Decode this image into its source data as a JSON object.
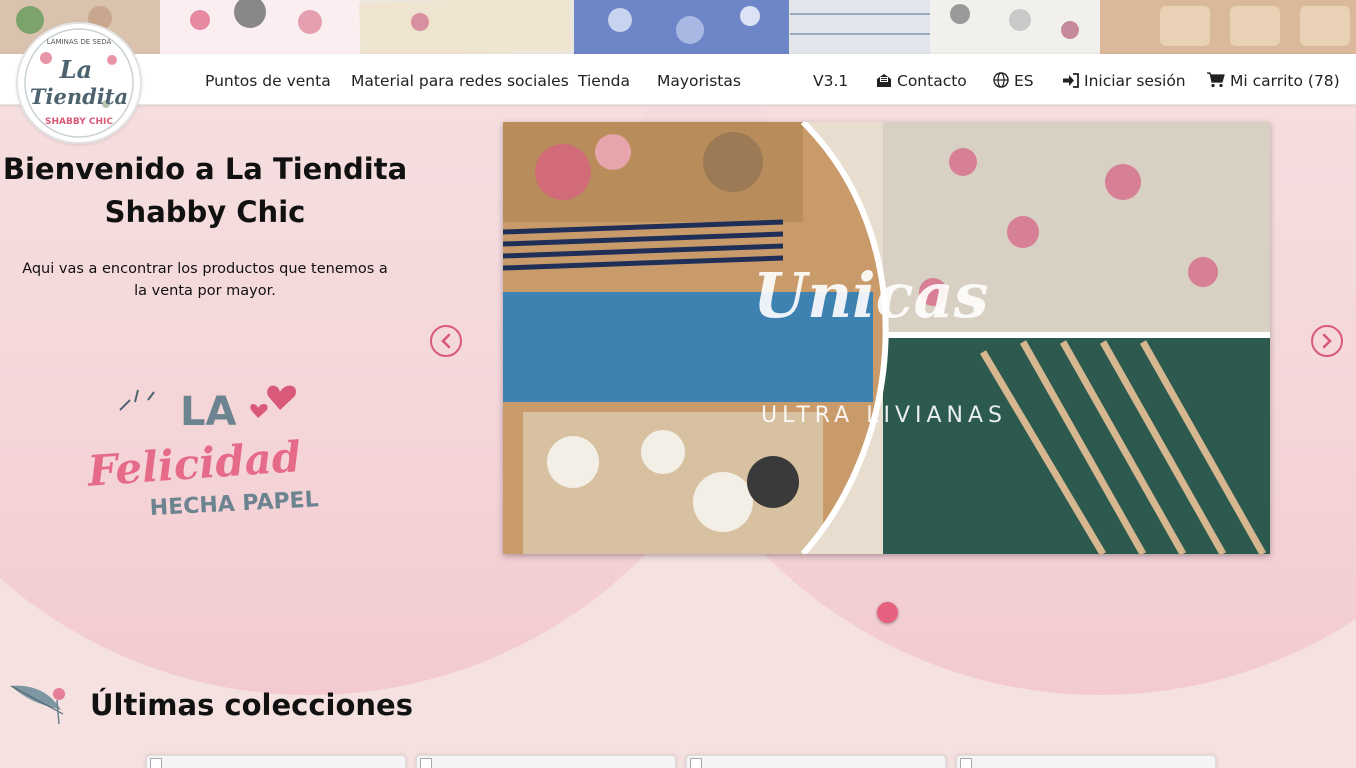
{
  "logo": {
    "top_text": "LÁMINAS DE SEDA",
    "main_line1": "La",
    "main_line2": "Tiendita",
    "bottom_text": "SHABBY CHIC"
  },
  "nav": {
    "left_items": [
      {
        "label": "Puntos de venta"
      },
      {
        "label": "Material para redes sociales"
      },
      {
        "label": "Tienda"
      },
      {
        "label": "Mayoristas"
      }
    ],
    "version": "V3.1",
    "contact": {
      "label": "Contacto",
      "icon": "envelope-open-icon"
    },
    "language": {
      "label": "ES",
      "icon": "globe-icon"
    },
    "login": {
      "label": "Iniciar sesión",
      "icon": "sign-in-icon"
    },
    "cart": {
      "label": "Mi carrito (78)",
      "icon": "shopping-cart-icon"
    }
  },
  "hero": {
    "title": "Bienvenido a La Tiendita Shabby Chic",
    "subtitle": "Aqui vas a encontrar los productos que tenemos a la venta por mayor.",
    "tagline": {
      "line1": "LA",
      "line2": "Felicidad",
      "line3": "HECHA PAPEL"
    }
  },
  "carousel": {
    "slide_text_main": "Unicas",
    "slide_text_sub": "ULTRA LIVIANAS",
    "prev_icon": "chevron-left-icon",
    "next_icon": "chevron-right-icon",
    "slide_count": 1,
    "active_slide": 1
  },
  "collections": {
    "title": "Últimas colecciones",
    "cards": [
      {},
      {},
      {},
      {}
    ]
  },
  "colors": {
    "accent": "#d95a78",
    "background": "#f6e1e1",
    "arc": "#efb7c2"
  }
}
